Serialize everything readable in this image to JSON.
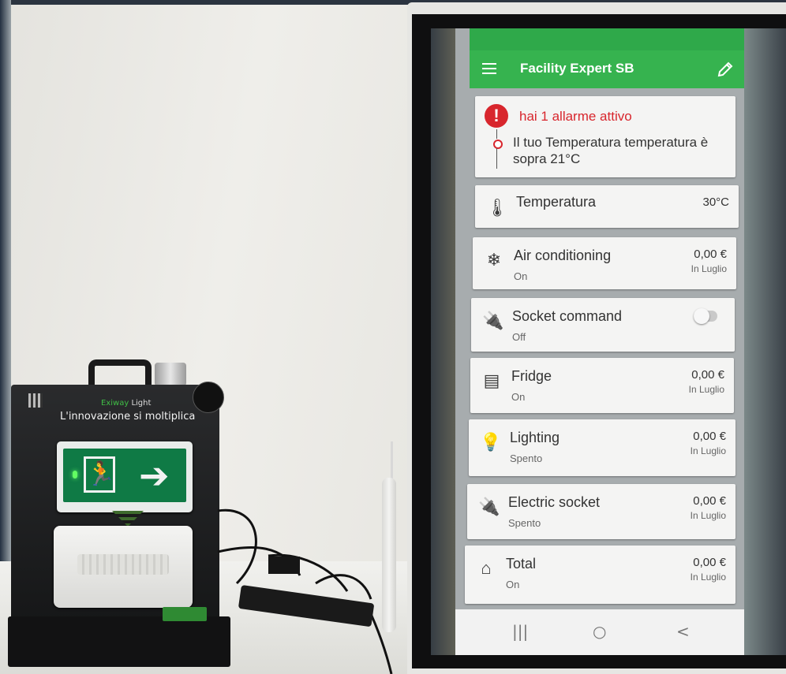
{
  "kit": {
    "brand": "Exiway",
    "product": "Light",
    "headline": "L'innovazione si moltiplica"
  },
  "app": {
    "title": "Facility Expert SB",
    "alarm": {
      "title": "hai 1 allarme attivo",
      "message": "Il tuo Temperatura temperatura è sopra 21°C"
    },
    "devices": [
      {
        "name": "Temperatura",
        "state": "",
        "value": "30°C",
        "period": "",
        "icon": "thermometer-alert-icon"
      },
      {
        "name": "Air conditioning",
        "state": "On",
        "value": "0,00 €",
        "period": "In Luglio",
        "icon": "snowflake-icon"
      },
      {
        "name": "Socket command",
        "state": "Off",
        "value": "",
        "period": "",
        "icon": "plug-icon",
        "toggle_on": false
      },
      {
        "name": "Fridge",
        "state": "On",
        "value": "0,00 €",
        "period": "In Luglio",
        "icon": "fridge-icon"
      },
      {
        "name": "Lighting",
        "state": "Spento",
        "value": "0,00 €",
        "period": "In Luglio",
        "icon": "lightbulb-icon"
      },
      {
        "name": "Electric socket",
        "state": "Spento",
        "value": "0,00 €",
        "period": "In Luglio",
        "icon": "plug-icon"
      },
      {
        "name": "Total",
        "state": "On",
        "value": "0,00 €",
        "period": "In Luglio",
        "icon": "home-icon"
      }
    ],
    "nav": {
      "recents": "|||",
      "home": "○",
      "back": "<"
    },
    "colors": {
      "app_bar": "#36b34f",
      "alarm": "#d8262d"
    }
  }
}
